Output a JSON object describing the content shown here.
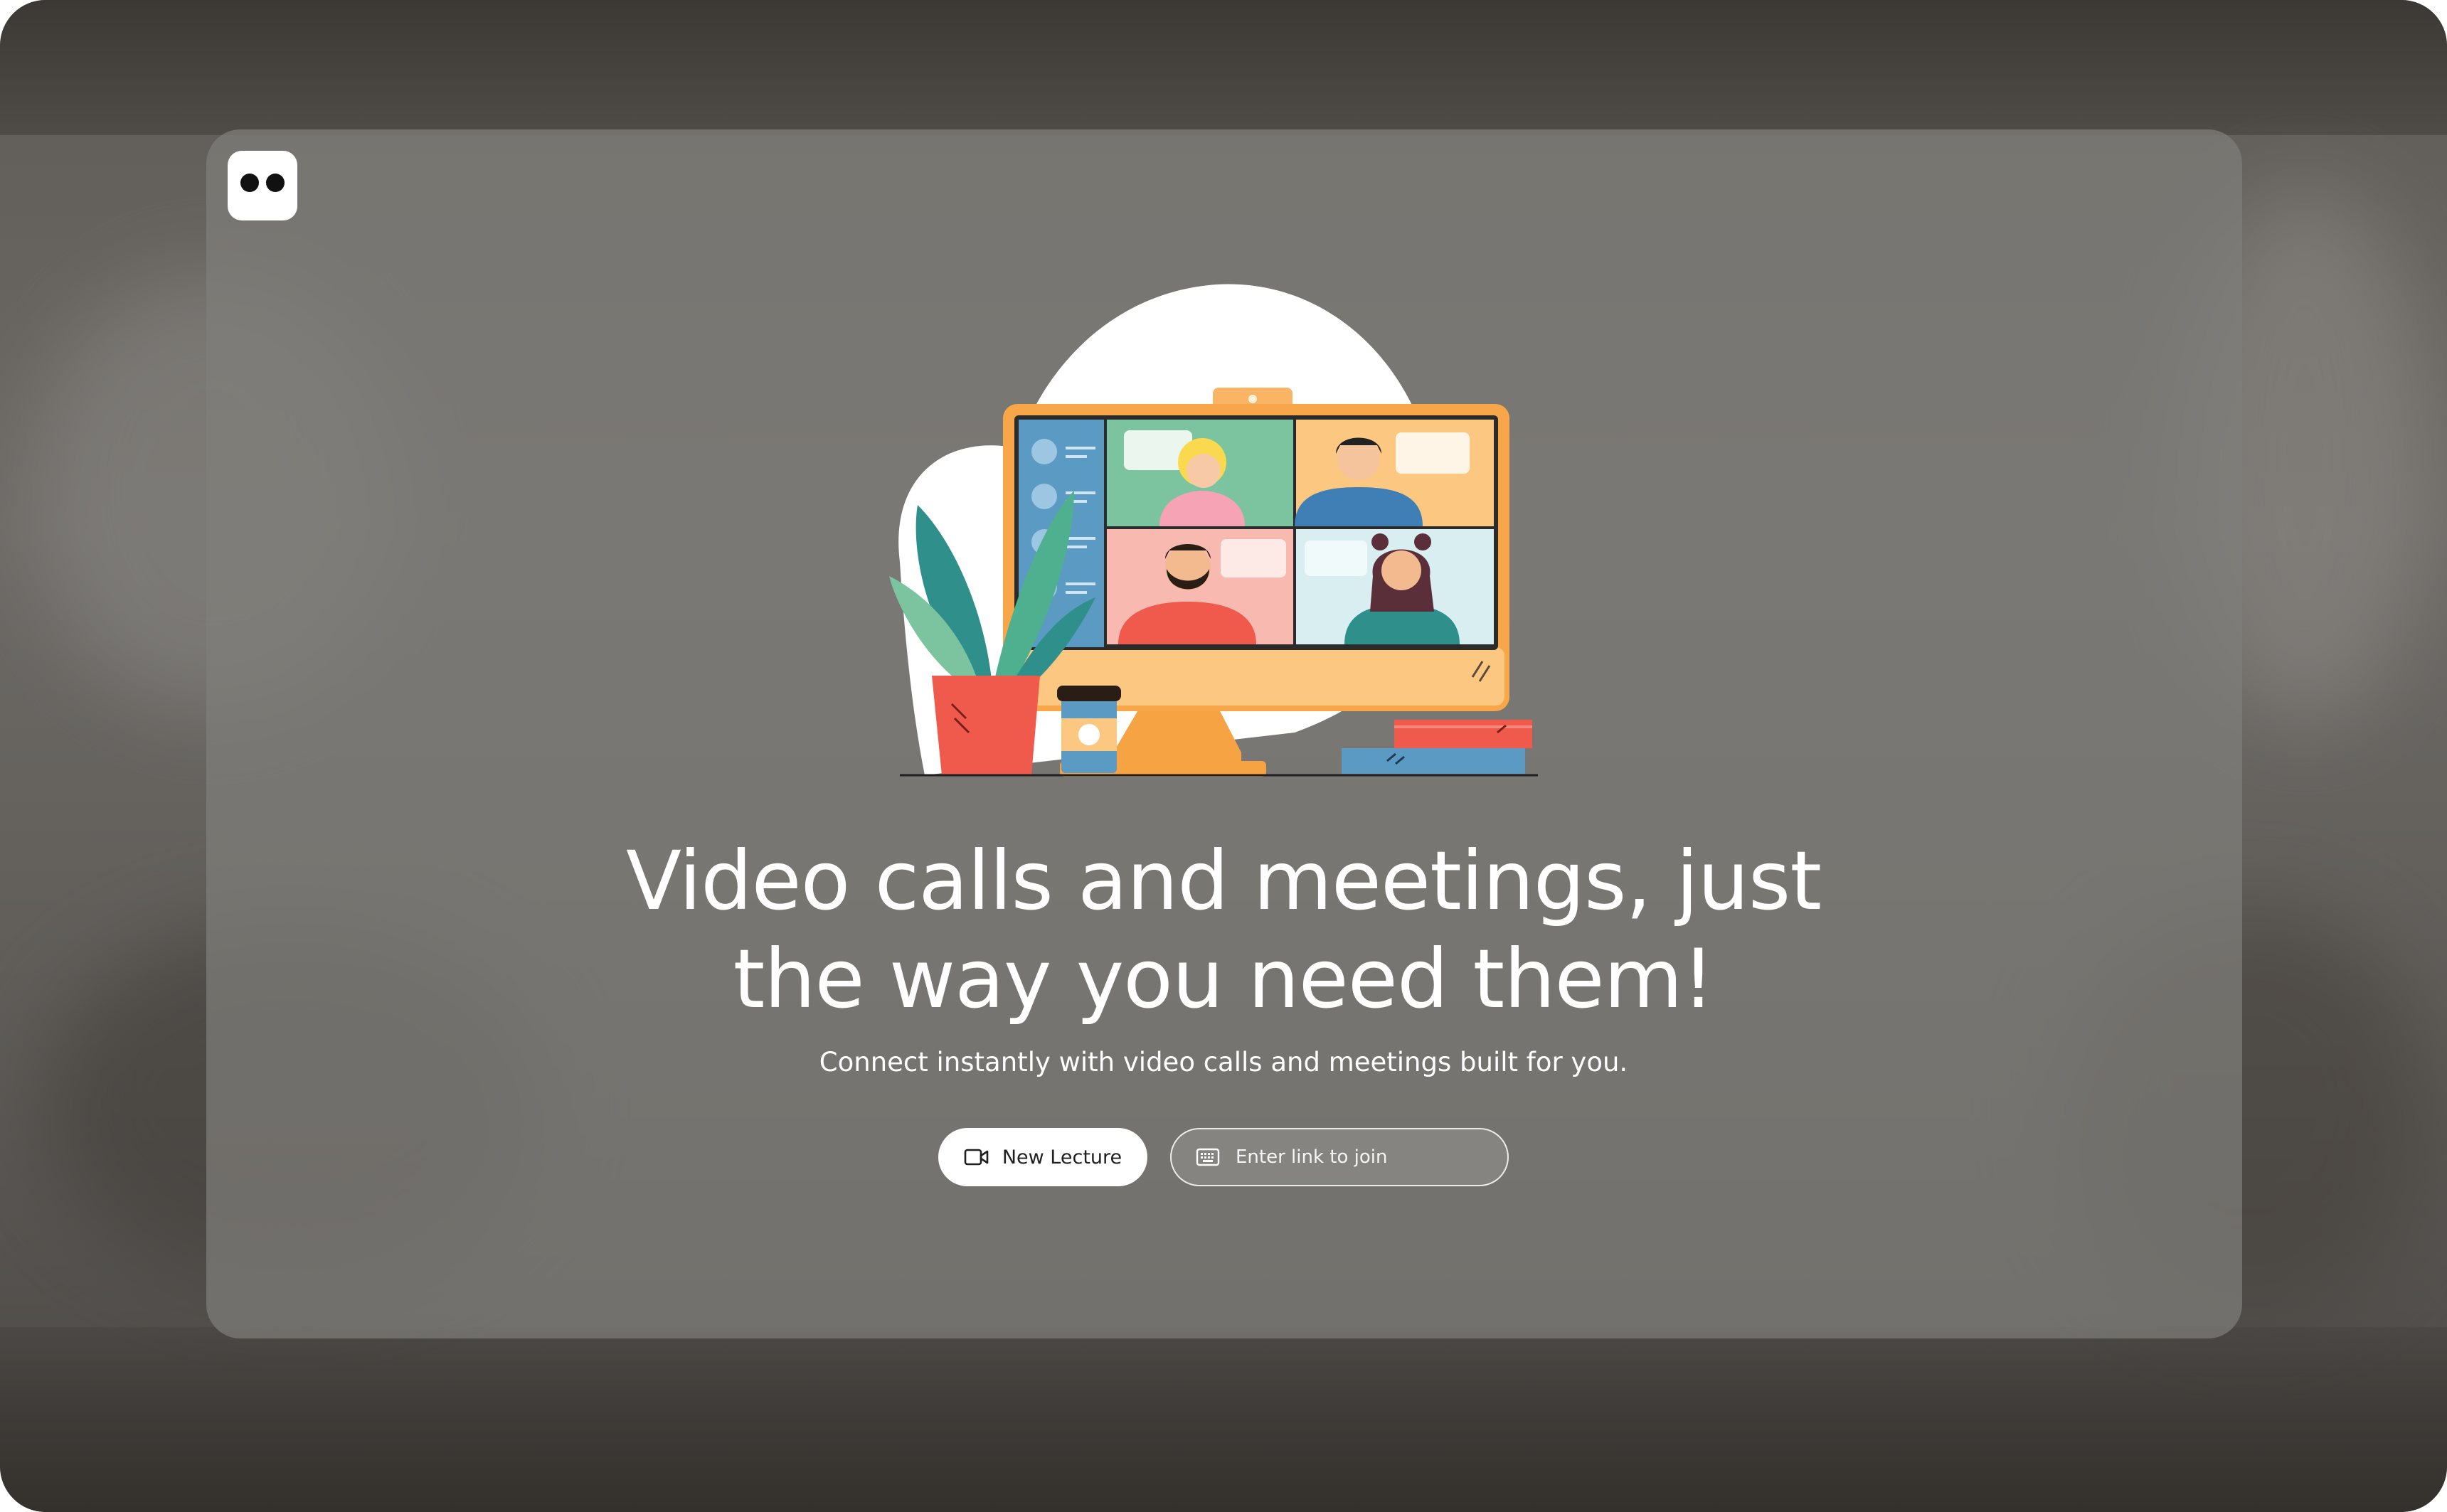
{
  "app": {
    "logo_icon": "eyes-logo-icon"
  },
  "hero": {
    "illustration_icon": "video-conference-illustration",
    "headline_line1": "Video calls and meetings, just",
    "headline_line2": "the way you need them!",
    "subtitle": "Connect instantly with video calls and meetings built for you."
  },
  "actions": {
    "new_lecture_label": "New Lecture",
    "new_lecture_icon": "video-camera-icon",
    "join_placeholder": "Enter link to join",
    "join_value": "",
    "join_icon": "keyboard-icon"
  },
  "colors": {
    "panel": "#807e7a",
    "text": "#ffffff",
    "button_bg": "#ffffff",
    "monitor": "#f7a74a",
    "screen_sidebar": "#5b9ac2"
  }
}
